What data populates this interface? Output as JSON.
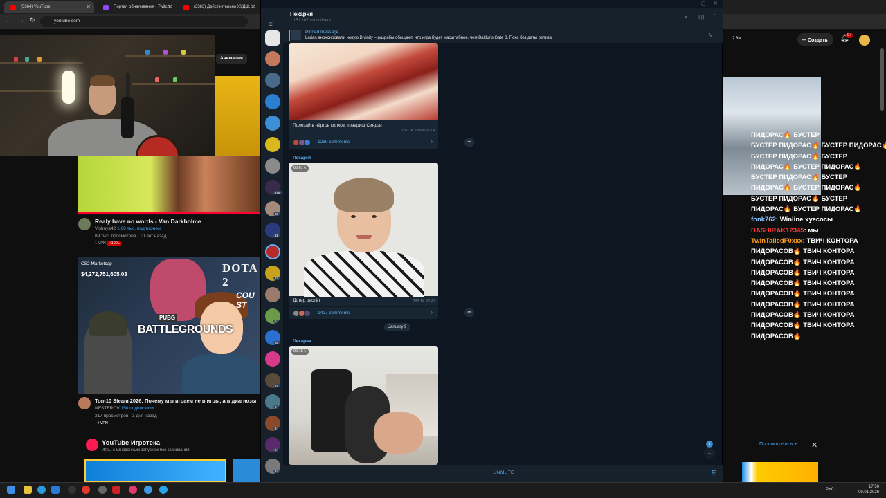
{
  "browser": {
    "tabs": [
      {
        "label": "(3364) YouTube",
        "color": "#ff0000"
      },
      {
        "label": "Портал обналивания - Twitch",
        "color": "#9146ff"
      },
      {
        "label": "(3363) Действительно ХУДШ...",
        "color": "#ff0000"
      }
    ],
    "url": "youtube.com"
  },
  "youtube": {
    "chip_label": "Анимация",
    "videos": [
      {
        "title": "Realy have no words - Van Darkholme",
        "channel": "Vishnya42",
        "subs": "1,08 тыс. подписчики",
        "meta": "89 тыс. просмотров · 10 лет назад",
        "tags": [
          "1 VPN",
          "+100ь"
        ]
      },
      {
        "title": "Топ-10 Steam 2026: Почему мы играем не в игры, а в диагнозы",
        "channel": "NESTEROV",
        "subs": "150 подписчики",
        "meta": "217 просмотров · 3 дня назад",
        "tags": [
          "4 VPN"
        ]
      }
    ],
    "cs2_thumb": {
      "label": "CS2 Marketcap",
      "price": "$4,272,751,605.03",
      "dota": "DOTA 2",
      "pubg": "BATTLEGROUNDS",
      "pubg_small": "PUBG",
      "cou": "COU ST"
    },
    "igroteka": {
      "title": "YouTube Игротека",
      "subtitle": "Игры с мгновенным запуском без скачивания"
    },
    "create_label": "Создать",
    "notif_count": "9+",
    "view_all": "Просмотреть все",
    "views_right": "2.3M"
  },
  "chat": [
    {
      "user": "",
      "text": "ПИДОРАС🔥 БУСТЕР"
    },
    {
      "user": "",
      "text": "БУСТЕР ПИДОРАС🔥 БУСТЕР ПИДОРАС🔥"
    },
    {
      "user": "",
      "text": "БУСТЕР ПИДОРАС🔥 БУСТЕР"
    },
    {
      "user": "",
      "text": "ПИДОРАС🔥 БУСТЕР ПИДОРАС🔥"
    },
    {
      "user": "",
      "text": "БУСТЕР ПИДОРАС🔥 БУСТЕР"
    },
    {
      "user": "",
      "text": "ПИДОРАС🔥 БУСТЕР ПИДОРАС🔥"
    },
    {
      "user": "",
      "text": "БУСТЕР ПИДОРАС🔥 БУСТЕР"
    },
    {
      "user": "",
      "text": "ПИДОРАС🔥 БУСТЕР ПИДОРАС🔥"
    },
    {
      "user": "fonk762",
      "userclass": "u1",
      "text": "Winline хуесосы"
    },
    {
      "user": "DASHIRAK12345",
      "userclass": "u2",
      "text": "мы"
    },
    {
      "user": "TwinTailedF0xxx",
      "userclass": "u3",
      "text": "ТВИЧ КОНТОРА"
    },
    {
      "user": "",
      "text": "ПИДОРАСОВ🔥 ТВИЧ КОНТОРА"
    },
    {
      "user": "",
      "text": "ПИДОРАСОВ🔥 ТВИЧ КОНТОРА"
    },
    {
      "user": "",
      "text": "ПИДОРАСОВ🔥 ТВИЧ КОНТОРА"
    },
    {
      "user": "",
      "text": "ПИДОРАСОВ🔥 ТВИЧ КОНТОРА"
    },
    {
      "user": "",
      "text": "ПИДОРАСОВ🔥 ТВИЧ КОНТОРА"
    },
    {
      "user": "",
      "text": "ПИДОРАСОВ🔥 ТВИЧ КОНТОРА"
    },
    {
      "user": "",
      "text": "ПИДОРАСОВ🔥 ТВИЧ КОНТОРА"
    },
    {
      "user": "",
      "text": "ПИДОРАСОВ🔥 ТВИЧ КОНТОРА"
    },
    {
      "user": "",
      "text": "ПИДОРАСОВ🔥"
    }
  ],
  "telegram": {
    "channel_title": "Пекарня",
    "subscribers": "1 151 167 subscribers",
    "pinned_label": "Pinned message",
    "pinned_text": "Larian анонсировали новую Divinity – разрабы обещают, что игра будет масштабнее, чем Baldur's Gate 3. Пока без даты релиза",
    "posts": [
      {
        "caption": "Полезай в чёртов колхоз, товарищ Синдзи",
        "stats": "287.2K  edited 21:04",
        "comments": "1239 comments"
      },
      {
        "author": "Пекарня",
        "duration": "00:01",
        "caption": "Дотер растёт",
        "stats": "283.1K  22:47",
        "comments": "1427 comments"
      },
      {
        "author": "Пекарня",
        "duration": "00:18"
      }
    ],
    "date_separator": "January 9",
    "unread_count": "1",
    "unmute_label": "UNMUTE",
    "rail_badges": [
      "576",
      "69",
      "11",
      "12",
      "6",
      "65",
      "2",
      "3",
      "2",
      "44",
      "23"
    ]
  },
  "taskbar": {
    "lang": "РУС",
    "time": "17:50",
    "date": "09.01.2026"
  }
}
